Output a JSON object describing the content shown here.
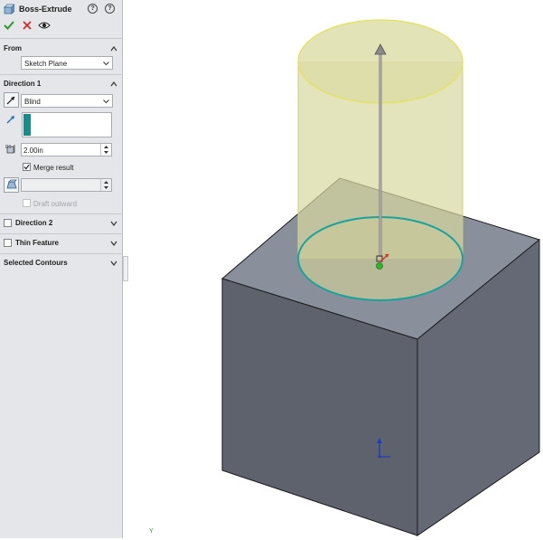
{
  "feature": {
    "title": "Boss-Extrude",
    "help_icons": [
      "help-icon",
      "detailed-preview-icon"
    ],
    "actions": [
      "ok-checkmark-icon",
      "cancel-x-icon",
      "preview-eye-icon"
    ]
  },
  "sections": {
    "from": {
      "label": "From",
      "value": "Sketch Plane"
    },
    "direction1": {
      "label": "Direction 1",
      "end_condition": "Blind",
      "depth": "2.00in",
      "merge_label": "Merge result",
      "merge_checked": true,
      "draft_label": "Draft outward",
      "draft_checked": false
    },
    "direction2": {
      "label": "Direction 2",
      "checked": false
    },
    "thin": {
      "label": "Thin Feature",
      "checked": false
    },
    "contours": {
      "label": "Selected Contours"
    }
  },
  "viewport": {
    "triad_label": "Y",
    "colors": {
      "box_front": "#5e626d",
      "box_right": "#656976",
      "box_top": "#8a8f9c",
      "cylinder": "#d8d9a0",
      "cylinder_edge": "#e3e35a",
      "contour": "#1aa39b",
      "accent": "#1a8a8a"
    }
  }
}
